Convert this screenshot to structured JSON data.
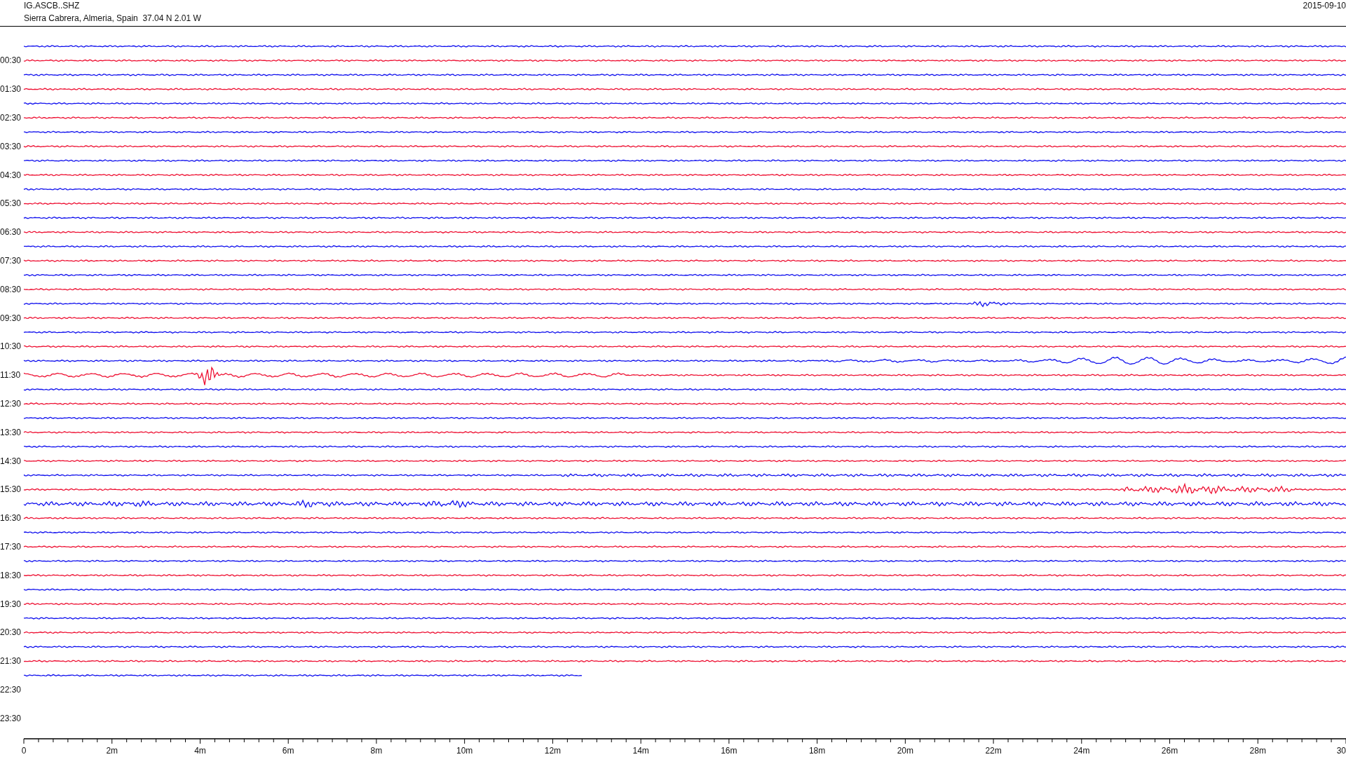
{
  "header": {
    "channel": "IG.ASCB..SHZ",
    "location": "Sierra Cabrera, Almeria, Spain  37.04 N 2.01 W",
    "date": "2015-09-10"
  },
  "hour_labels": [
    "00:30",
    "01:30",
    "02:30",
    "03:30",
    "04:30",
    "05:30",
    "06:30",
    "07:30",
    "08:30",
    "09:30",
    "10:30",
    "11:30",
    "12:30",
    "13:30",
    "14:30",
    "15:30",
    "16:30",
    "17:30",
    "18:30",
    "19:30",
    "20:30",
    "21:30",
    "22:30",
    "23:30"
  ],
  "x_axis": {
    "tick_labels": [
      "0",
      "2m",
      "4m",
      "6m",
      "8m",
      "10m",
      "12m",
      "14m",
      "16m",
      "18m",
      "20m",
      "22m",
      "24m",
      "26m",
      "28m",
      "30"
    ]
  }
}
